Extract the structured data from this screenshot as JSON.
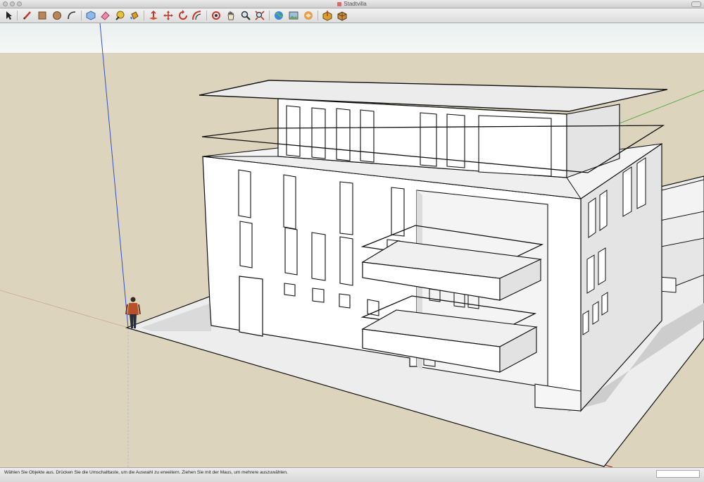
{
  "window": {
    "title": "Stadtvilla"
  },
  "toolbar": {
    "tools": [
      {
        "icon": "select-arrow-icon",
        "tooltip": "Auswählen"
      },
      {
        "icon": "pencil-line-icon",
        "tooltip": "Linie"
      },
      {
        "icon": "rectangle-icon",
        "tooltip": "Rechteck"
      },
      {
        "icon": "circle-icon",
        "tooltip": "Kreis"
      },
      {
        "icon": "arc-icon",
        "tooltip": "Bogen"
      },
      {
        "icon": "make-component-icon",
        "tooltip": "Komponente erstellen"
      },
      {
        "icon": "eraser-icon",
        "tooltip": "Radiergummi"
      },
      {
        "icon": "tape-measure-icon",
        "tooltip": "Maßband"
      },
      {
        "icon": "paint-bucket-icon",
        "tooltip": "Farbeimer"
      },
      {
        "icon": "push-pull-icon",
        "tooltip": "Drücken/Ziehen"
      },
      {
        "icon": "move-icon",
        "tooltip": "Verschieben"
      },
      {
        "icon": "rotate-icon",
        "tooltip": "Drehen"
      },
      {
        "icon": "offset-icon",
        "tooltip": "Versatz"
      },
      {
        "icon": "orbit-icon",
        "tooltip": "Orbit"
      },
      {
        "icon": "pan-hand-icon",
        "tooltip": "Schwenken"
      },
      {
        "icon": "zoom-icon",
        "tooltip": "Zoom"
      },
      {
        "icon": "zoom-extents-icon",
        "tooltip": "Zoom Grenzen"
      },
      {
        "icon": "google-earth-icon",
        "tooltip": "Google Earth"
      },
      {
        "icon": "photo-textures-icon",
        "tooltip": "Fototexturen"
      },
      {
        "icon": "3d-warehouse-icon",
        "tooltip": "3D Warehouse"
      },
      {
        "icon": "share-model-icon",
        "tooltip": "Modell freigeben"
      },
      {
        "icon": "extension-warehouse-icon",
        "tooltip": "Extension Warehouse"
      }
    ]
  },
  "statusbar": {
    "hint": "Wählen Sie Objekte aus. Drücken Sie die Umschalttaste, um die Auswahl zu erweitern. Ziehen Sie mit der Maus, um mehrere auszuwählen.",
    "measurements_value": ""
  },
  "colors": {
    "ground": "#ddd4bd",
    "sky": "#eef2f1",
    "wall_light": "#ffffff",
    "wall_shade": "#e8e8e8",
    "shadow": "#cfcfcf",
    "axis_red": "#b03020",
    "axis_green": "#4cab3c",
    "axis_blue": "#3050c8"
  }
}
